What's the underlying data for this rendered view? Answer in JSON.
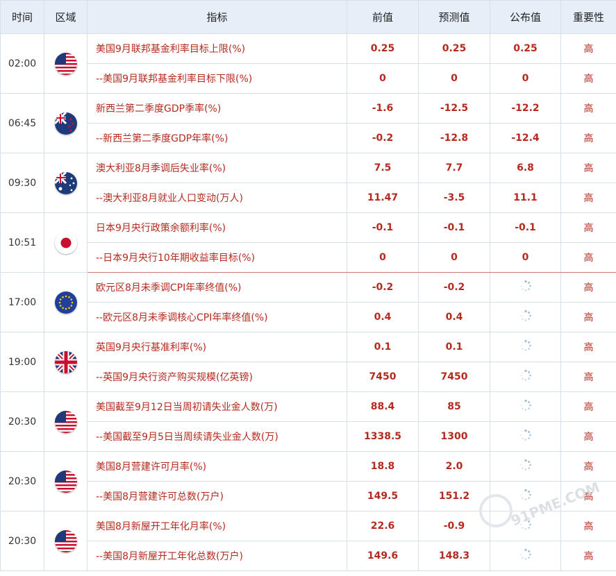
{
  "headers": {
    "time": "时间",
    "region": "区域",
    "indicator": "指标",
    "previous": "前值",
    "forecast": "预测值",
    "actual": "公布值",
    "importance": "重要性"
  },
  "groups": [
    {
      "time": "02:00",
      "flag": "us-flag-icon",
      "rows": [
        {
          "indicator": "美国9月联邦基金利率目标上限(%)",
          "previous": "0.25",
          "forecast": "0.25",
          "actual": "0.25",
          "importance": "高"
        },
        {
          "indicator": "--美国9月联邦基金利率目标下限(%)",
          "previous": "0",
          "forecast": "0",
          "actual": "0",
          "importance": "高"
        }
      ]
    },
    {
      "time": "06:45",
      "flag": "nz-flag-icon",
      "rows": [
        {
          "indicator": "新西兰第二季度GDP季率(%)",
          "previous": "-1.6",
          "forecast": "-12.5",
          "actual": "-12.2",
          "importance": "高"
        },
        {
          "indicator": "--新西兰第二季度GDP年率(%)",
          "previous": "-0.2",
          "forecast": "-12.8",
          "actual": "-12.4",
          "importance": "高"
        }
      ]
    },
    {
      "time": "09:30",
      "flag": "au-flag-icon",
      "rows": [
        {
          "indicator": "澳大利亚8月季调后失业率(%)",
          "previous": "7.5",
          "forecast": "7.7",
          "actual": "6.8",
          "importance": "高"
        },
        {
          "indicator": "--澳大利亚8月就业人口变动(万人)",
          "previous": "11.47",
          "forecast": "-3.5",
          "actual": "11.1",
          "importance": "高"
        }
      ]
    },
    {
      "time": "10:51",
      "flag": "jp-flag-icon",
      "rows": [
        {
          "indicator": "日本9月央行政策余额利率(%)",
          "previous": "-0.1",
          "forecast": "-0.1",
          "actual": "-0.1",
          "importance": "高"
        },
        {
          "indicator": "--日本9月央行10年期收益率目标(%)",
          "previous": "0",
          "forecast": "0",
          "actual": "0",
          "importance": "高"
        }
      ]
    },
    {
      "time": "17:00",
      "flag": "eu-flag-icon",
      "rows": [
        {
          "indicator": "欧元区8月未季调CPI年率终值(%)",
          "previous": "-0.2",
          "forecast": "-0.2",
          "actual": "",
          "importance": "高"
        },
        {
          "indicator": "--欧元区8月未季调核心CPI年率终值(%)",
          "previous": "0.4",
          "forecast": "0.4",
          "actual": "",
          "importance": "高"
        }
      ]
    },
    {
      "time": "19:00",
      "flag": "uk-flag-icon",
      "rows": [
        {
          "indicator": "英国9月央行基准利率(%)",
          "previous": "0.1",
          "forecast": "0.1",
          "actual": "",
          "importance": "高"
        },
        {
          "indicator": "--英国9月央行资产购买规模(亿英镑)",
          "previous": "7450",
          "forecast": "7450",
          "actual": "",
          "importance": "高"
        }
      ]
    },
    {
      "time": "20:30",
      "flag": "us-flag-icon",
      "rows": [
        {
          "indicator": "美国截至9月12日当周初请失业金人数(万)",
          "previous": "88.4",
          "forecast": "85",
          "actual": "",
          "importance": "高"
        },
        {
          "indicator": "--美国截至9月5日当周续请失业金人数(万)",
          "previous": "1338.5",
          "forecast": "1300",
          "actual": "",
          "importance": "高"
        }
      ]
    },
    {
      "time": "20:30",
      "flag": "us-flag-icon",
      "rows": [
        {
          "indicator": "美国8月营建许可月率(%)",
          "previous": "18.8",
          "forecast": "2.0",
          "actual": "",
          "importance": "高"
        },
        {
          "indicator": "--美国8月营建许可总数(万户)",
          "previous": "149.5",
          "forecast": "151.2",
          "actual": "",
          "importance": "高"
        }
      ]
    },
    {
      "time": "20:30",
      "flag": "us-flag-icon",
      "rows": [
        {
          "indicator": "美国8月新屋开工年化月率(%)",
          "previous": "22.6",
          "forecast": "-0.9",
          "actual": "",
          "importance": "高"
        },
        {
          "indicator": "--美国8月新屋开工年化总数(万户)",
          "previous": "149.6",
          "forecast": "148.3",
          "actual": "",
          "importance": "高"
        }
      ]
    }
  ],
  "watermark": "91PME.COM"
}
